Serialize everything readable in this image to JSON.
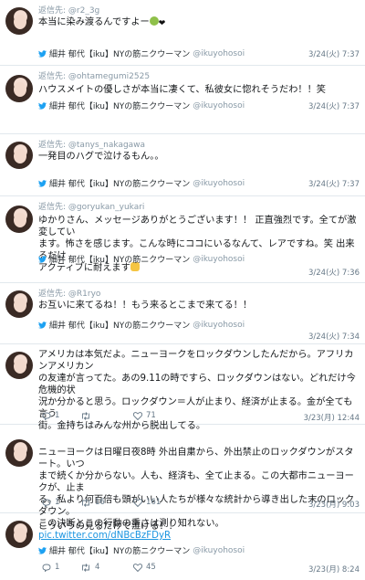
{
  "tweets": [
    {
      "reply_prefix": "返信先: ",
      "reply_handle": "@r2_3g",
      "text": "本当に染み渡るんですよー",
      "emoji": [
        "cry-emoji",
        "heart-emoji"
      ],
      "rt_name": "細井 郁代【iku】NYの筋ニクウーマン",
      "rt_handle": "@ikuyohosoi",
      "time": "3/24(火) 7:37"
    },
    {
      "reply_prefix": "返信先: ",
      "reply_handle": "@ohtamegumi2525",
      "text": "ハウスメイトの優しさが本当に凄くて、私彼女に惚れそうだわ！！笑",
      "rt_name": "細井 郁代【iku】NYの筋ニクウーマン",
      "rt_handle": "@ikuyohosoi",
      "time": "3/24(火) 7:37"
    },
    {
      "reply_prefix": "返信先: ",
      "reply_handle": "@tanys_nakagawa",
      "text": "一発目のハグで泣けるもん。。",
      "rt_name": "細井 郁代【iku】NYの筋ニクウーマン",
      "rt_handle": "@ikuyohosoi",
      "time": "3/24(火) 7:37"
    },
    {
      "reply_prefix": "返信先: ",
      "reply_handle": "@goryukan_yukari",
      "text_lines": [
        "ゆかりさん、メッセージありがとうございます！！ 正直強烈です。全てが激変してい",
        "ます。怖さを感じます。こんな時にココにいるなんて、レアですね。笑 出来るだけ",
        "アクティブに耐えます"
      ],
      "emoji": [
        "flexed-biceps-emoji"
      ],
      "rt_name": "細井 郁代【iku】NYの筋ニクウーマン",
      "rt_handle": "@ikuyohosoi",
      "time": "3/24(火) 7:36"
    },
    {
      "reply_prefix": "返信先: ",
      "reply_handle": "@R1ryo",
      "text": "お互いに来てるね！！もう来るとこまで来てる！！",
      "rt_name": "細井 郁代【iku】NYの筋ニクウーマン",
      "rt_handle": "@ikuyohosoi",
      "time": "3/24(火) 7:34"
    },
    {
      "text_lines": [
        "アメリカは本気だよ。ニューヨークをロックダウンしたんだから。アフリカンアメリカン",
        "の友達が言ってた。あの9.11の時ですら、ロックダウンはない。どれだけ今危機的状",
        "況か分かると思う。ロックダウン＝人が止まり、経済が止まる。金が全ても言う",
        "街。金持ちはみんな州から脱出してる。"
      ],
      "reply_count": "1",
      "retweet_count": "",
      "like_count": "71",
      "time": "3/23(月) 12:44"
    },
    {
      "text_lines": [
        "ニューヨークは日曜日夜8時 外出自粛から、外出禁止のロックダウンがスタート。いつ",
        "まで続くか分からない。人も、経済も、全て止まる。この大都市ニューヨークが、止ま",
        "る。私より何百倍も頭がいい人たちが様々な統計から導き出した末のロックダウン。",
        "この決断とこの行動の重さは測り知れない。 "
      ],
      "link": "pic.twitter.com/dNBcBzFDyR",
      "reply_count": "1",
      "retweet_count": "16",
      "like_count": "161",
      "time": "3/23(月) 9:03"
    },
    {
      "text": "こういうの見るだけで泣ける！！",
      "rt_name": "細井 郁代【iku】NYの筋ニクウーマン",
      "rt_handle": "@ikuyohosoi",
      "reply_count": "1",
      "retweet_count": "4",
      "like_count": "45",
      "time": "3/23(月) 8:24"
    }
  ]
}
